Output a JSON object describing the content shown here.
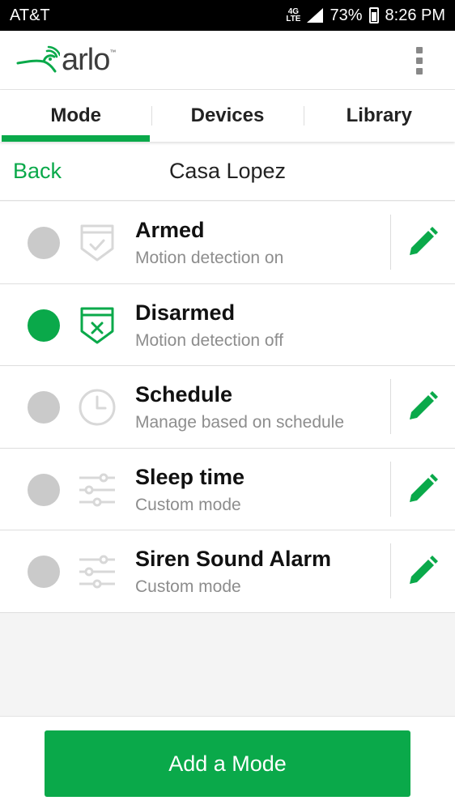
{
  "status_bar": {
    "carrier": "AT&T",
    "network": "4G LTE",
    "battery": "73%",
    "time": "8:26 PM"
  },
  "app": {
    "logo_text": "arlo",
    "logo_tm": "™"
  },
  "tabs": [
    {
      "label": "Mode",
      "active": true
    },
    {
      "label": "Devices",
      "active": false
    },
    {
      "label": "Library",
      "active": false
    }
  ],
  "sub_header": {
    "back_label": "Back",
    "title": "Casa Lopez"
  },
  "modes": [
    {
      "name": "Armed",
      "description": "Motion detection on",
      "selected": false,
      "icon": "shield-check-icon",
      "editable": true
    },
    {
      "name": "Disarmed",
      "description": "Motion detection off",
      "selected": true,
      "icon": "shield-x-icon",
      "editable": false
    },
    {
      "name": "Schedule",
      "description": "Manage based on schedule",
      "selected": false,
      "icon": "clock-icon",
      "editable": true
    },
    {
      "name": "Sleep time",
      "description": "Custom mode",
      "selected": false,
      "icon": "sliders-icon",
      "editable": true
    },
    {
      "name": "Siren Sound Alarm",
      "description": "Custom mode",
      "selected": false,
      "icon": "sliders-icon",
      "editable": true
    }
  ],
  "add_button": {
    "label": "Add a Mode"
  },
  "colors": {
    "accent": "#0aa94a",
    "radio_inactive": "#cacaca",
    "icon_inactive": "#d8d8d8"
  }
}
